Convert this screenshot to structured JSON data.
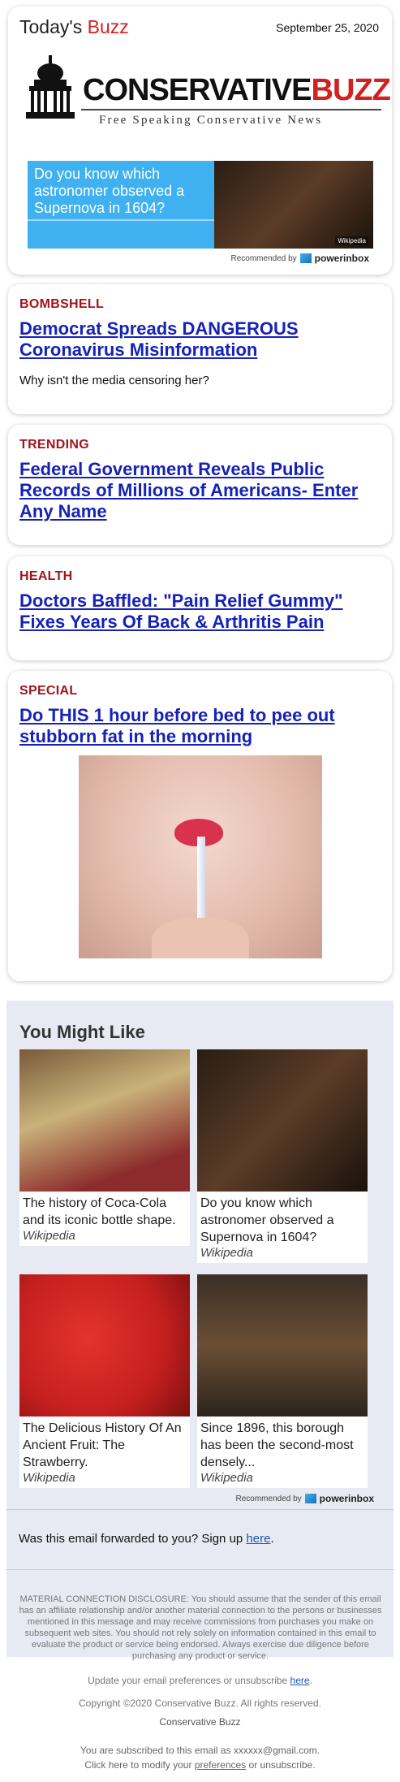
{
  "header": {
    "brand_prefix": "Today's ",
    "brand_suffix": "Buzz",
    "date": "September 25, 2020",
    "logo_word_1": "CONSERVATIVE",
    "logo_word_2": "BUZZ",
    "logo_tagline": "Free Speaking Conservative News",
    "ad_text": "Do you know which astronomer observed a Supernova in 1604?",
    "ad_credit": "Wikipedia",
    "recommended_by": "Recommended by",
    "powerinbox": "powerinbox"
  },
  "articles": [
    {
      "category": "BOMBSHELL",
      "headline": "Democrat Spreads DANGEROUS Coronavirus Misinformation",
      "subtext": "Why isn't the media censoring her?"
    },
    {
      "category": "TRENDING",
      "headline": "Federal Government Reveals Public Records of Millions of Americans- Enter Any Name"
    },
    {
      "category": "HEALTH",
      "headline": "Doctors Baffled: \"Pain Relief Gummy\" Fixes Years Of Back & Arthritis Pain"
    },
    {
      "category": "SPECIAL",
      "headline": "Do THIS 1 hour before bed to pee out stubborn fat in the morning"
    }
  ],
  "you_might_like": {
    "title": "You Might Like",
    "items": [
      {
        "caption": "The history of Coca-Cola and its iconic bottle shape.",
        "source": "Wikipedia"
      },
      {
        "caption": "Do you know which astronomer observed a Supernova in 1604?",
        "source": "Wikipedia"
      },
      {
        "caption": "The Delicious History Of An Ancient Fruit: The Strawberry.",
        "source": "Wikipedia"
      },
      {
        "caption": "Since 1896, this borough has been the second-most densely...",
        "source": "Wikipedia"
      }
    ],
    "recommended_by": "Recommended by",
    "powerinbox": "powerinbox"
  },
  "forward": {
    "text": "Was this email forwarded to you? Sign up ",
    "link": "here",
    "end": "."
  },
  "disclosure": "MATERIAL CONNECTION DISCLOSURE: You should assume that the sender of this email has an affiliate relationship and/or another material connection to the persons or businesses mentioned in this message and may receive commissions from purchases you make on subsequent web sites. You should not rely solely on information contained in this email to evaluate the product or service being endorsed. Always exercise due diligence before purchasing any product or service.",
  "update": {
    "text": "Update your email preferences or unsubscribe ",
    "link": "here",
    "end": "."
  },
  "footer": {
    "copyright": "Copyright ©2020 Conservative Buzz. All rights reserved.",
    "brand": "Conservative Buzz",
    "subscribed": "You are subscribed to this email as xxxxxx@gmail.com.",
    "modify_prefix": "Click here to modify your ",
    "modify_link": "preferences",
    "modify_suffix": " or unsubscribe."
  },
  "colors": {
    "accent_red": "#d32020",
    "category_red": "#a3141c",
    "link_blue": "#1622b8",
    "panel_bg": "#e8eaf3",
    "ad_blue": "#3fb1f0"
  }
}
